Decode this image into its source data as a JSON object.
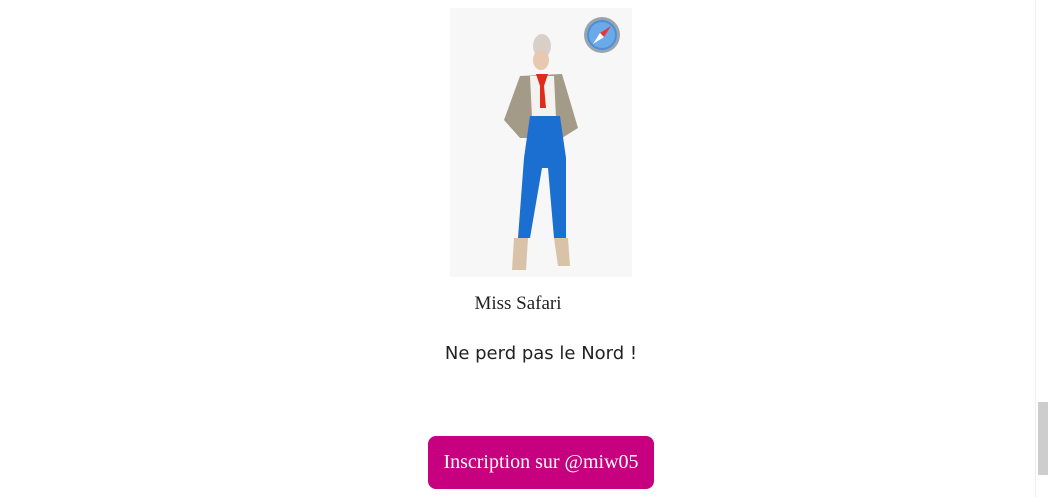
{
  "product": {
    "image_alt": "Miss Safari",
    "name": "Miss Safari",
    "tagline": "Ne perd pas le Nord !",
    "icon": "safari-compass-icon"
  },
  "cta": {
    "label": "Inscription sur @miw05",
    "color": "#c6007e"
  },
  "scrollbar": {
    "position_fraction": 0.95
  }
}
